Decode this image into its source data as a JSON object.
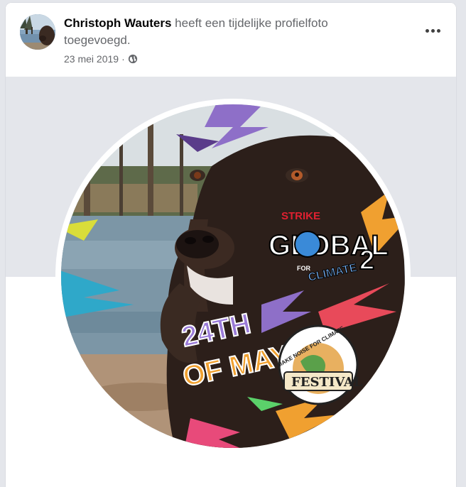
{
  "post": {
    "author": "Christoph Wauters",
    "action": "heeft een tijdelijke profielfoto toegevoegd.",
    "date": "23 mei 2019",
    "separator": "·",
    "privacy_icon": "globe-icon",
    "more_icon": "more-options-icon"
  },
  "profile_photo": {
    "frame_logo_top": "STRIKE",
    "frame_logo_main": "GLOBAL",
    "frame_logo_for": "FOR",
    "frame_logo_sub": "CLIMATE",
    "frame_logo_num": "2",
    "date_line1": "24TH",
    "date_line2": "OF MAY",
    "arc_text": "MAKE NOISE FOR CLIMATE",
    "festival": "FESTIVAL"
  },
  "colors": {
    "page_bg": "#e4e6eb",
    "card_bg": "#ffffff",
    "name": "#050505",
    "secondary": "#65676b"
  }
}
